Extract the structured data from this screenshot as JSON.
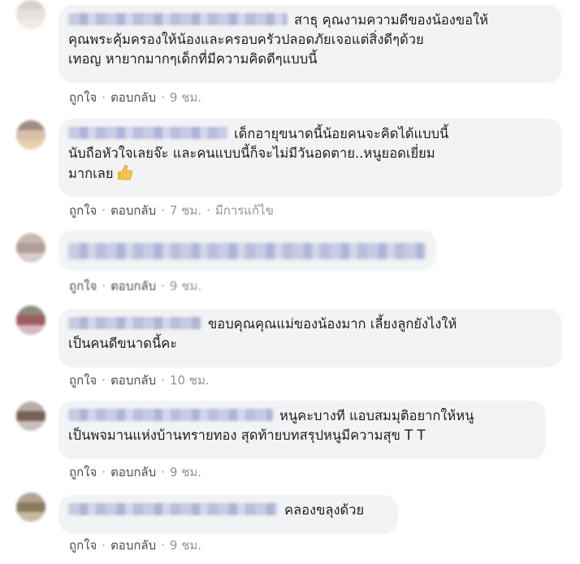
{
  "comments": [
    {
      "text_line1": "สาธุ คุณงามความดีของน้องขอให้",
      "text_line2": "คุณพระคุ้มครองให้น้องและครอบครัวปลอดภัยเจอแต่สิ่งดีๆด้วย",
      "text_line3": "เทอญ หายากมากๆเด็กที่มีความคิดดีๆแบบนี้",
      "like_label": "ถูกใจ",
      "reply_label": "ตอบกลับ",
      "time": "9 ชม."
    },
    {
      "text_line1": "เด็กอายุขนาดนี้น้อยคนจะคิดได้แบบนี้",
      "text_line2": "นับถือหัวใจเลยจ๊ะ และคนแบบนี้ก็จะไม่มีวันอดตาย..หนูยอดเยี่ยม",
      "text_line3": "มากเลย",
      "emoji": "thumbs-up-icon",
      "like_label": "ถูกใจ",
      "reply_label": "ตอบกลับ",
      "time": "7 ชม.",
      "edited_label": "มีการแก้ไข"
    },
    {
      "like_label": "ถูกใจ",
      "reply_label": "ตอบกลับ",
      "time": "9 ชม."
    },
    {
      "text_line1": "ขอบคุณคุณแม่ของน้องมาก เลี้ยงลูกยังไงให้",
      "text_line2": "เป็นคนดีขนาดนี้คะ",
      "like_label": "ถูกใจ",
      "reply_label": "ตอบกลับ",
      "time": "10 ชม."
    },
    {
      "text_line1": "หนูคะบางที แอบสมมุติอยากให้หนู",
      "text_line2": "เป็นพจมานแห่งบ้านทรายทอง สุดท้ายบทสรุปหนูมีความสุข T T",
      "like_label": "ถูกใจ",
      "reply_label": "ตอบกลับ",
      "time": "9 ชม."
    },
    {
      "text_line1": "คลองขลุงด้วย",
      "like_label": "ถูกใจ",
      "reply_label": "ตอบกลับ",
      "time": "9 ชม."
    }
  ],
  "colors": {
    "bubble_bg": "#f2f3f5",
    "text": "#1c1e21",
    "action_text": "#606770"
  }
}
